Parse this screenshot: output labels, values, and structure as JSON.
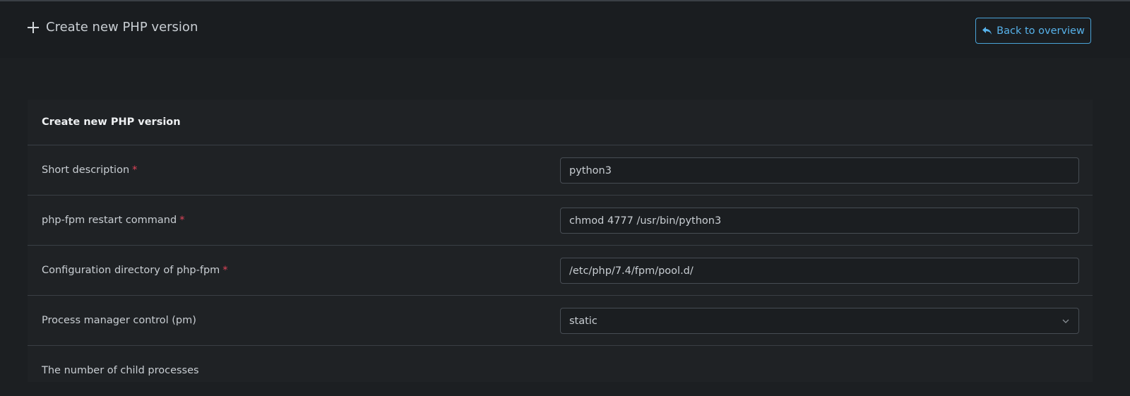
{
  "header": {
    "title": "Create new PHP version",
    "back_label": "Back to overview"
  },
  "colors": {
    "accent": "#57b2ea",
    "required": "#e0455a",
    "background": "#1c1f22"
  },
  "card": {
    "title": "Create new PHP version",
    "rows": [
      {
        "label": "Short description",
        "required": "*",
        "value": "python3"
      },
      {
        "label": "php-fpm restart command",
        "required": "*",
        "value": "chmod 4777 /usr/bin/python3"
      },
      {
        "label": "Configuration directory of php-fpm",
        "required": "*",
        "value": "/etc/php/7.4/fpm/pool.d/"
      },
      {
        "label": "Process manager control (pm)",
        "selected": "static"
      },
      {
        "label": "The number of child processes"
      }
    ]
  },
  "icons": {
    "title_icon": "plus-icon",
    "back_icon": "reply-arrow-icon",
    "select_icon": "chevron-down-icon"
  }
}
